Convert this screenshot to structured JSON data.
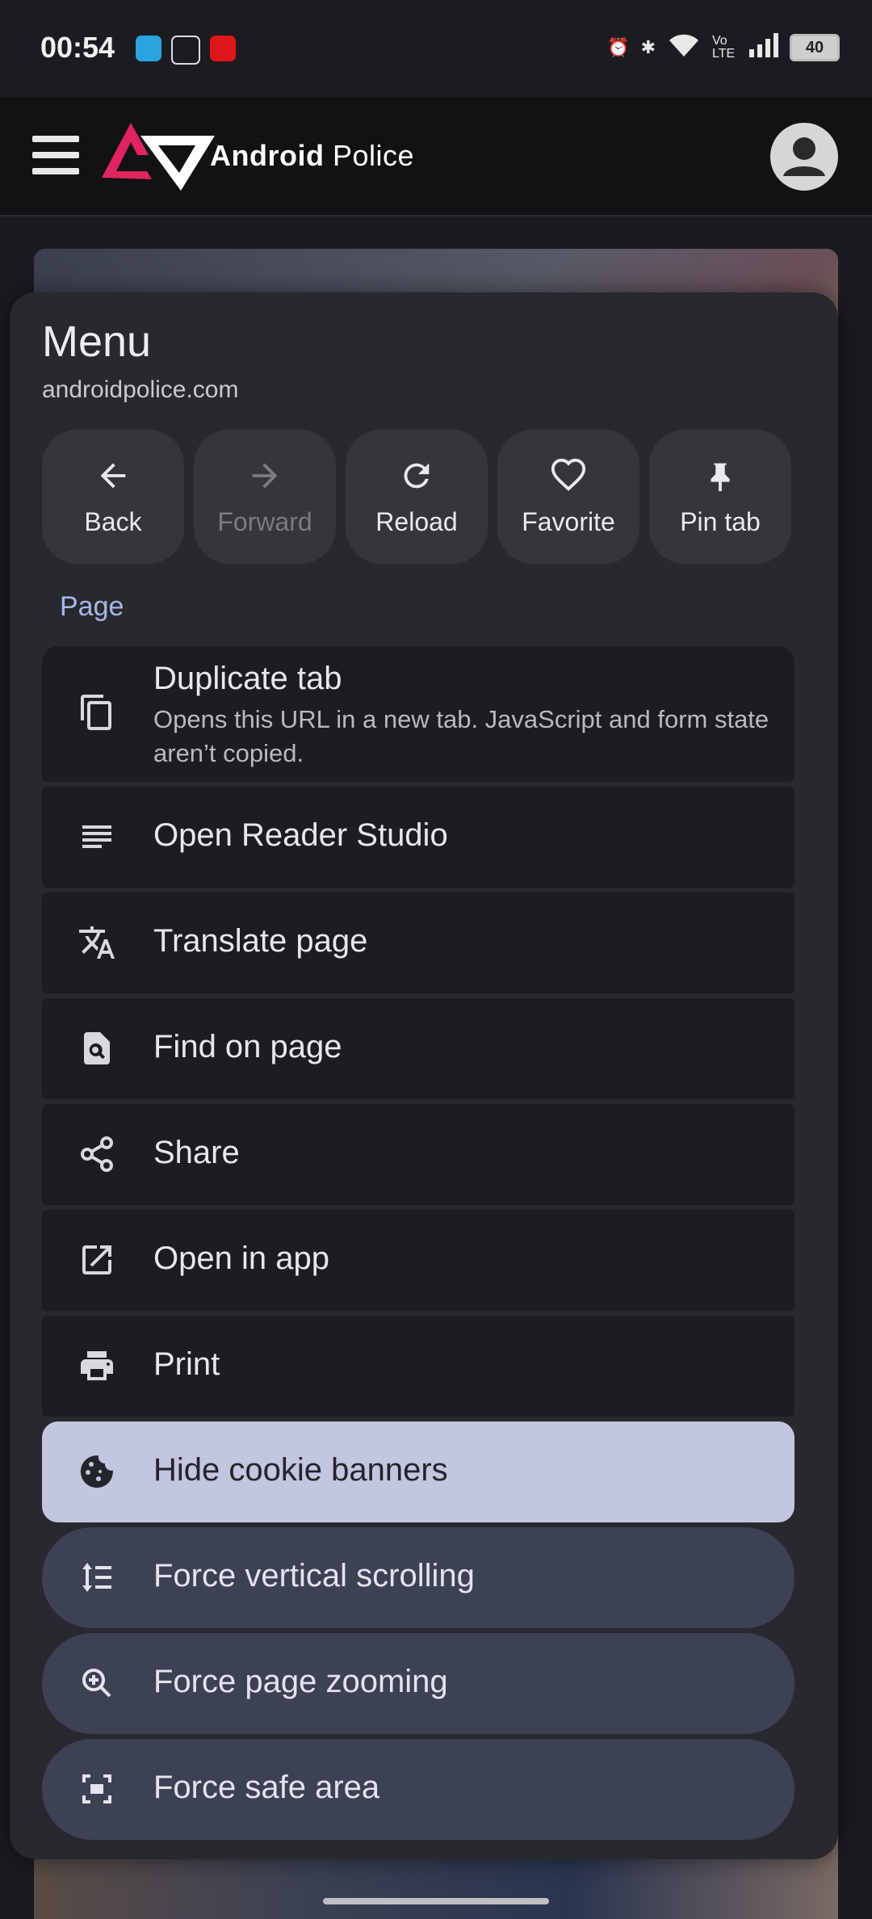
{
  "status": {
    "time": "00:54",
    "battery": "40",
    "network": "Vo LTE"
  },
  "site": {
    "brand_bold": "Android",
    "brand_light": "Police"
  },
  "menu": {
    "title": "Menu",
    "url": "androidpolice.com",
    "actions": [
      {
        "label": "Back",
        "icon": "arrow-left-icon",
        "enabled": true
      },
      {
        "label": "Forward",
        "icon": "arrow-right-icon",
        "enabled": false
      },
      {
        "label": "Reload",
        "icon": "reload-icon",
        "enabled": true
      },
      {
        "label": "Favorite",
        "icon": "heart-icon",
        "enabled": true
      },
      {
        "label": "Pin tab",
        "icon": "pin-icon",
        "enabled": true
      }
    ],
    "section": "Page",
    "items": [
      {
        "label": "Duplicate tab",
        "description": "Opens this URL in a new tab. JavaScript and form state aren’t copied.",
        "icon": "copy-icon"
      },
      {
        "label": "Open Reader Studio",
        "icon": "reader-icon"
      },
      {
        "label": "Translate page",
        "icon": "translate-icon"
      },
      {
        "label": "Find on page",
        "icon": "find-in-page-icon"
      },
      {
        "label": "Share",
        "icon": "share-icon"
      },
      {
        "label": "Open in app",
        "icon": "open-external-icon"
      },
      {
        "label": "Print",
        "icon": "print-icon"
      }
    ],
    "toggles": [
      {
        "label": "Hide cookie banners",
        "icon": "cookie-icon",
        "active": true
      },
      {
        "label": "Force vertical scrolling",
        "icon": "vertical-scroll-icon",
        "active": false
      },
      {
        "label": "Force page zooming",
        "icon": "zoom-in-icon",
        "active": false
      },
      {
        "label": "Force safe area",
        "icon": "safe-area-icon",
        "active": false
      }
    ]
  }
}
